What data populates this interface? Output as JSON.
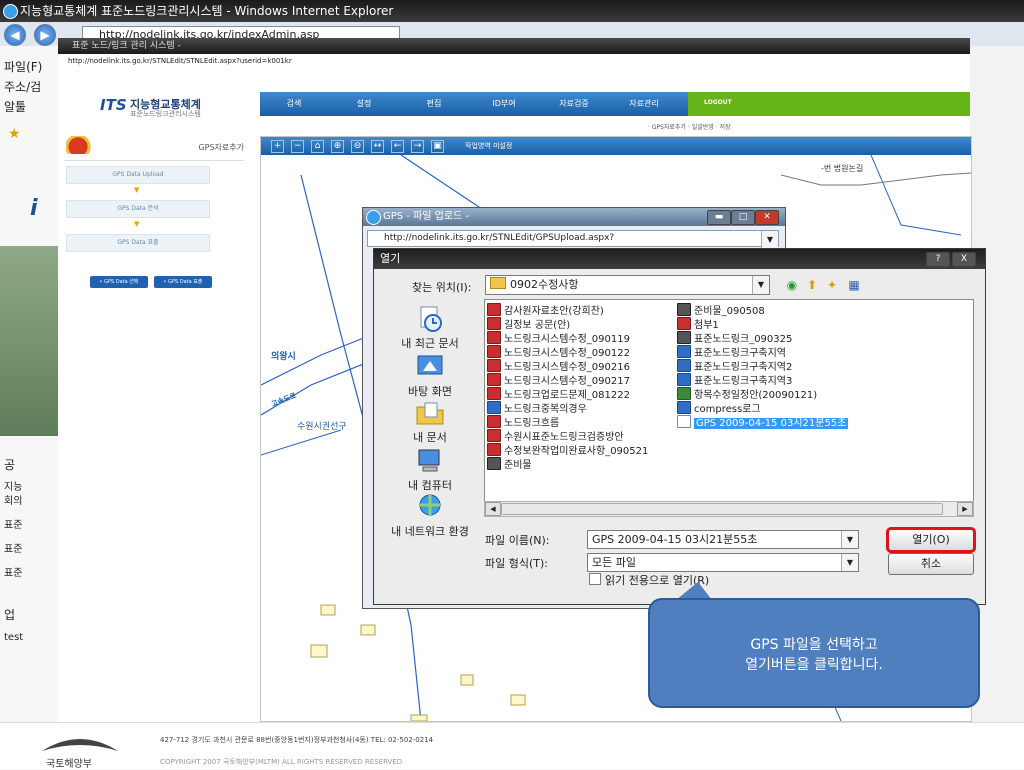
{
  "outer_window": {
    "title": "지능형교통체계 표준노드링크관리시스템 - Windows Internet Explorer",
    "url": "http://nodelink.its.go.kr/indexAdmin.asp",
    "left_labels": [
      "파일(F)",
      "주소/검",
      "알툴",
      "공",
      "지능",
      "회의",
      "표준",
      "표준",
      "표준",
      "업",
      "test"
    ]
  },
  "inner_window": {
    "title": "표준 노드/링크 관리 시스템 -",
    "url": "http://nodelink.its.go.kr/STNLEdit/STNLEdit.aspx?userid=k001kr"
  },
  "app": {
    "logo_mark": "ITS",
    "logo_name": "지능형교통체계",
    "logo_sub": "표준노드링크관리시스템",
    "menu": [
      "검색",
      "설정",
      "편집",
      "ID부여",
      "자료검증",
      "자료관리"
    ],
    "logout": "LOGOUT",
    "submenu": "· GPS자료추가  · 일괄반영  · 저장",
    "panel_title": "GPS자료추가",
    "steps": [
      "GPS Data Upload",
      "GPS Data 분석",
      "GPS Data 표출"
    ],
    "step_arrow": "▼",
    "buttons": [
      "• GPS Data 선택",
      "• GPS Data 표출"
    ]
  },
  "map": {
    "status": "작업영역 미설정",
    "labels": [
      "의왕시",
      "수원시권선구",
      "고속도로",
      "-번 법원논길"
    ]
  },
  "footer": {
    "address": "427-712 경기도 과천시 관문로 88번(중앙동1번지)정부과천청사(4동)  TEL: 02-502-0214",
    "copyright": "COPYRIGHT  2007 국토해양부(MLTM) ALL RIGHTS RESERVED   RESERVED",
    "logo": "국토해양부"
  },
  "upload_window": {
    "title": "GPS - 파일 업로드 -",
    "url": "http://nodelink.its.go.kr/STNLEdit/GPSUpload.aspx?"
  },
  "open_dialog": {
    "title": "열기",
    "help": "?",
    "close": "X",
    "look_in_label": "찾는 위치(I):",
    "look_in_value": "0902수정사항",
    "places": [
      "내 최근 문서",
      "바탕 화면",
      "내 문서",
      "내 컴퓨터",
      "내 네트워크 환경"
    ],
    "files_col1": [
      {
        "name": "감사원자료초안(강희찬)",
        "type": "doc"
      },
      {
        "name": "길정보 공문(안)",
        "type": "doc"
      },
      {
        "name": "노드링크시스템수정_090119",
        "type": "doc"
      },
      {
        "name": "노드링크시스템수정_090122",
        "type": "doc"
      },
      {
        "name": "노드링크시스템수정_090216",
        "type": "doc"
      },
      {
        "name": "노드링크시스템수정_090217",
        "type": "doc"
      },
      {
        "name": "노드링크업로드문제_081222",
        "type": "doc"
      },
      {
        "name": "노드링크중복의경우",
        "type": "hwp"
      },
      {
        "name": "노드링크흐름",
        "type": "doc"
      },
      {
        "name": "수원시표준노드링크검증방안",
        "type": "doc"
      },
      {
        "name": "수정보완작업미완료사항_090521",
        "type": "doc"
      },
      {
        "name": "준비물",
        "type": "zip"
      }
    ],
    "files_col2": [
      {
        "name": "준비물_090508",
        "type": "zip"
      },
      {
        "name": "첨부1",
        "type": "doc"
      },
      {
        "name": "표준노드링크_090325",
        "type": "zip"
      },
      {
        "name": "표준노드링크구축지역",
        "type": "hwp"
      },
      {
        "name": "표준노드링크구축지역2",
        "type": "hwp"
      },
      {
        "name": "표준노드링크구축지역3",
        "type": "hwp"
      },
      {
        "name": "항목수정일정안(20090121)",
        "type": "xls"
      },
      {
        "name": "compress로그",
        "type": "hwp"
      },
      {
        "name": "GPS 2009-04-15 03시21분55초",
        "type": "txt",
        "selected": true
      }
    ],
    "filename_label": "파일 이름(N):",
    "filename_value": "GPS 2009-04-15 03시21분55초",
    "filetype_label": "파일 형식(T):",
    "filetype_value": "모든 파일",
    "readonly_label": "읽기 전용으로 열기(R)",
    "open_button": "열기(O)",
    "cancel_button": "취소"
  },
  "callout": {
    "line1": "GPS 파일을 선택하고",
    "line2": "열기버튼을 클릭합니다."
  }
}
